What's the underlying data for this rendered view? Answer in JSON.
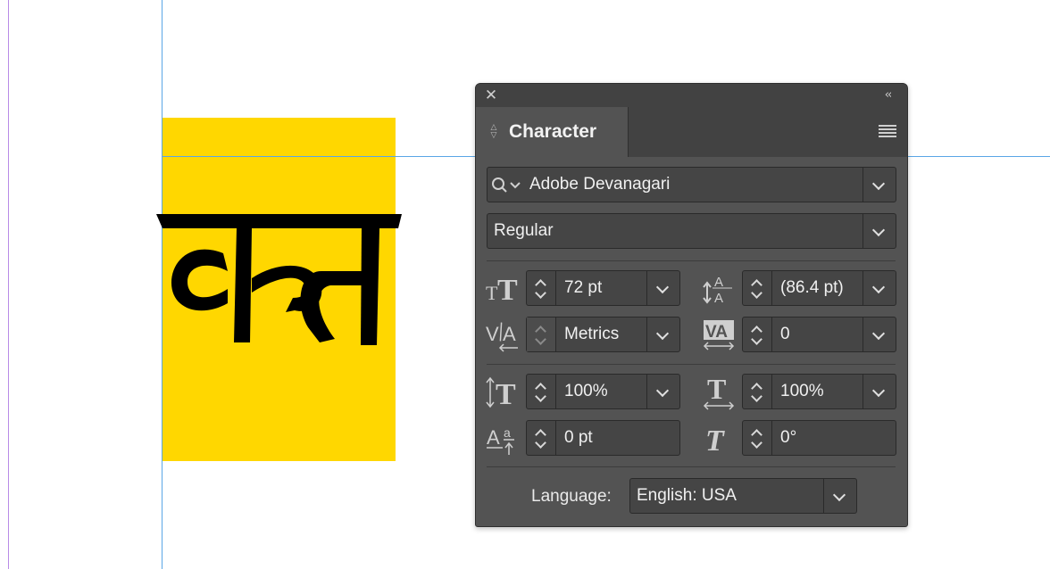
{
  "canvas": {
    "glyph_text": "क्त",
    "frame_color": "#ffd700"
  },
  "panel": {
    "close_icon": "close-icon",
    "collapse_icon": "double-chevron-left-icon",
    "tab_label": "Character",
    "menu_icon": "panel-menu-icon",
    "font_family": "Adobe Devanagari",
    "font_style": "Regular",
    "font_size": "72 pt",
    "leading": "(86.4 pt)",
    "kerning": "Metrics",
    "tracking": "0",
    "vertical_scale": "100%",
    "horizontal_scale": "100%",
    "baseline_shift": "0 pt",
    "skew": "0°",
    "language_label": "Language:",
    "language_value": "English: USA"
  },
  "colors": {
    "panel_bg": "#535353",
    "field_bg": "#454545",
    "guide_blue": "#5aa6e6",
    "margin_purple": "#b98be6"
  }
}
